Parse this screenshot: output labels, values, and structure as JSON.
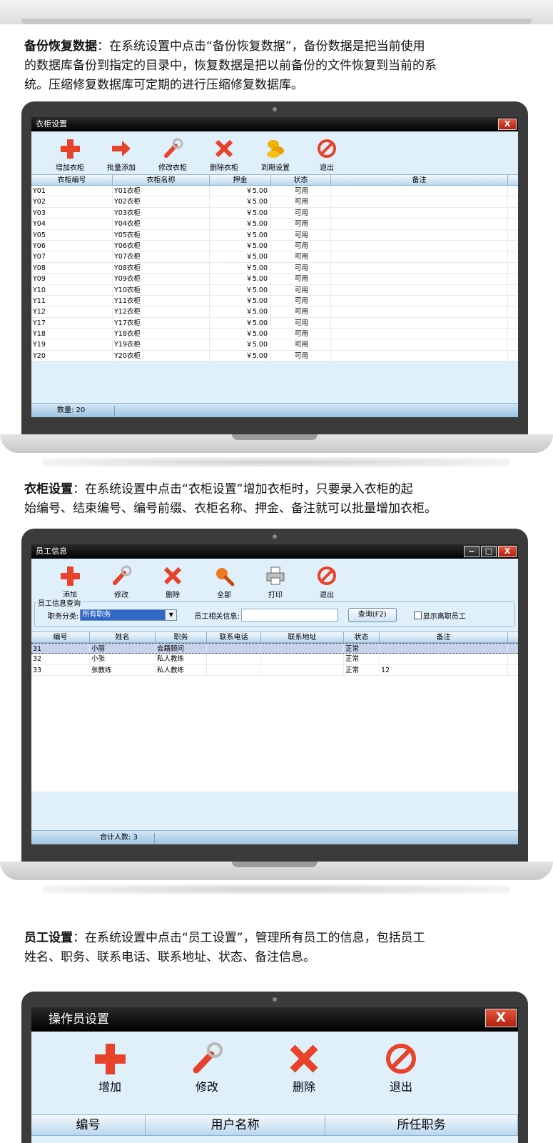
{
  "sections": [
    {
      "heading": "备份恢复数据",
      "body_line1": "：在系统设置中点击“备份恢复数据”，备份数据是把当前使用",
      "body_line2": "的数据库备份到指定的目录中，恢复数据是把以前备份的文件恢复到当前的系",
      "body_line3": "统。压缩修复数据库可定期的进行压缩修复数据库。"
    },
    {
      "heading": "衣柜设置",
      "body_line1": "：在系统设置中点击“衣柜设置”增加衣柜时，只要录入衣柜的起",
      "body_line2": "始编号、结束编号、编号前缀、衣柜名称、押金、备注就可以批量增加衣柜。"
    },
    {
      "heading": "员工设置",
      "body_line1": "：在系统设置中点击“员工设置”，管理所有员工的信息，包括员工",
      "body_line2": "姓名、职务、联系电话、联系地址、状态、备注信息。"
    }
  ],
  "locker_window": {
    "title": "衣柜设置",
    "close": "X",
    "toolbar": [
      "增加衣柜",
      "批量添加",
      "修改衣柜",
      "删除衣柜",
      "到期设置",
      "退出"
    ],
    "columns": [
      "衣柜编号",
      "衣柜名称",
      "押金",
      "状态",
      "备注"
    ],
    "rows": [
      [
        "Y01",
        "Y01衣柜",
        "￥5.00",
        "可用",
        ""
      ],
      [
        "Y02",
        "Y02衣柜",
        "￥5.00",
        "可用",
        ""
      ],
      [
        "Y03",
        "Y03衣柜",
        "￥5.00",
        "可用",
        ""
      ],
      [
        "Y04",
        "Y04衣柜",
        "￥5.00",
        "可用",
        ""
      ],
      [
        "Y05",
        "Y05衣柜",
        "￥5.00",
        "可用",
        ""
      ],
      [
        "Y06",
        "Y06衣柜",
        "￥5.00",
        "可用",
        ""
      ],
      [
        "Y07",
        "Y07衣柜",
        "￥5.00",
        "可用",
        ""
      ],
      [
        "Y08",
        "Y08衣柜",
        "￥5.00",
        "可用",
        ""
      ],
      [
        "Y09",
        "Y09衣柜",
        "￥5.00",
        "可用",
        ""
      ],
      [
        "Y10",
        "Y10衣柜",
        "￥5.00",
        "可用",
        ""
      ],
      [
        "Y11",
        "Y11衣柜",
        "￥5.00",
        "可用",
        ""
      ],
      [
        "Y12",
        "Y12衣柜",
        "￥5.00",
        "可用",
        ""
      ],
      [
        "Y17",
        "Y17衣柜",
        "￥5.00",
        "可用",
        ""
      ],
      [
        "Y18",
        "Y18衣柜",
        "￥5.00",
        "可用",
        ""
      ],
      [
        "Y19",
        "Y19衣柜",
        "￥5.00",
        "可用",
        ""
      ],
      [
        "Y20",
        "Y20衣柜",
        "￥5.00",
        "可用",
        ""
      ]
    ],
    "footer": "数量: 20"
  },
  "staff_window": {
    "title": "员工信息",
    "btn_min": "−",
    "btn_max": "□",
    "close": "X",
    "toolbar": [
      "添加",
      "修改",
      "删除",
      "全部",
      "打印",
      "退出"
    ],
    "search_legend": "员工信息查询",
    "category_label": "职务分类:",
    "category_value": "所有职务",
    "info_label": "员工相关信息:",
    "info_value": "",
    "query_button": "查询(F2)",
    "show_resigned": "显示离职员工",
    "columns": [
      "编号",
      "姓名",
      "职务",
      "联系电话",
      "联系地址",
      "状态",
      "备注"
    ],
    "rows": [
      [
        "31",
        "小丽",
        "会籍顾问",
        "",
        "",
        "正常",
        ""
      ],
      [
        "32",
        "小张",
        "私人教练",
        "",
        "",
        "正常",
        ""
      ],
      [
        "33",
        "张教练",
        "私人教练",
        "",
        "",
        "正常",
        "12"
      ]
    ],
    "footer": "合计人数: 3"
  },
  "operator_window": {
    "title": "操作员设置",
    "close": "X",
    "toolbar": [
      "增加",
      "修改",
      "删除",
      "退出"
    ],
    "columns": [
      "编号",
      "用户名称",
      "所任职务"
    ]
  },
  "colors": {
    "screen_bg": "#dff0fa",
    "titlebar": "#000000",
    "close_red": "#c9301a",
    "icon_red": "#e8432a",
    "grid_header": "#b9d7ee",
    "selection": "#c8d2ea",
    "laptop_bezel": "#3b3b3b"
  }
}
